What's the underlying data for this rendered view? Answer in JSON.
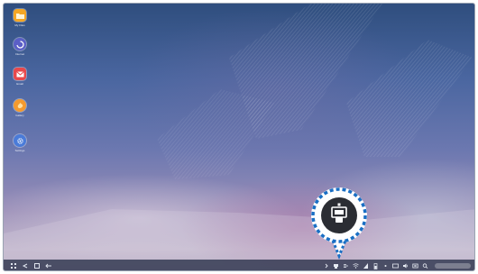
{
  "desktop": {
    "icons": [
      {
        "label": "My Files",
        "icon": "folder-icon",
        "color": "#f5a623"
      },
      {
        "label": "Internet",
        "icon": "internet-icon",
        "color": "#5b5fc7"
      },
      {
        "label": "Email",
        "icon": "email-icon",
        "color": "#e8484c"
      },
      {
        "label": "Gallery",
        "icon": "gallery-icon",
        "color": "#f59a2e"
      },
      {
        "label": "Settings",
        "icon": "settings-icon",
        "color": "#4a7bd8"
      }
    ]
  },
  "taskbar": {
    "nav": [
      "apps-icon",
      "back-icon",
      "home-icon",
      "recent-apps-icon"
    ],
    "tray": [
      "expand-icon",
      "dex-station-icon",
      "usb-icon",
      "wifi-icon",
      "signal-icon",
      "battery-icon",
      "notification-icon",
      "messages-icon",
      "volume-icon",
      "screenshot-icon",
      "search-icon"
    ]
  },
  "callout": {
    "highlighted_icon": "dex-station-icon",
    "ring_color": "#1a6fc4"
  }
}
